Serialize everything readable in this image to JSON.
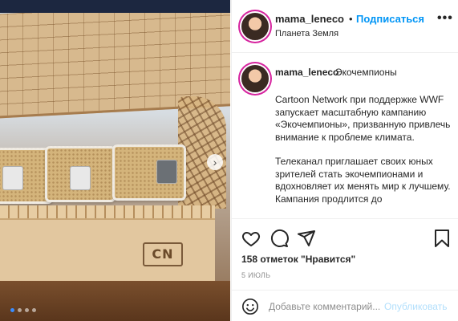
{
  "header": {
    "username": "mama_leneco",
    "bullet": "•",
    "follow_label": "Подписаться",
    "location": "Планета Земля",
    "more_label": "•••"
  },
  "caption": {
    "username": "mama_leneco",
    "title": "Экочемпионы",
    "paragraphs": [
      "Cartoon Network при поддержке WWF запускает масштабную кампанию «Экочемпионы», призванную привлечь внимание к проблеме климата.",
      "Телеканал приглашает своих юных зрителей стать экочемпионами и вдохновляет их менять мир к лучшему. Кампания продлится до"
    ]
  },
  "media": {
    "logo_text": "CN",
    "next_arrow": "›",
    "carousel_total": 4,
    "carousel_active": 1
  },
  "actions": {
    "icons": [
      "heart-icon",
      "comment-icon",
      "share-icon",
      "bookmark-icon"
    ],
    "likes_text": "158 отметок \"Нравится\"",
    "date_text": "5 ИЮЛЬ"
  },
  "comment": {
    "placeholder": "Добавьте комментарий...",
    "publish_label": "Опубликовать"
  },
  "colors": {
    "accent": "#0095f6",
    "publish_disabled": "#b2dffc",
    "text": "#262626",
    "muted": "#8e8e8e"
  }
}
